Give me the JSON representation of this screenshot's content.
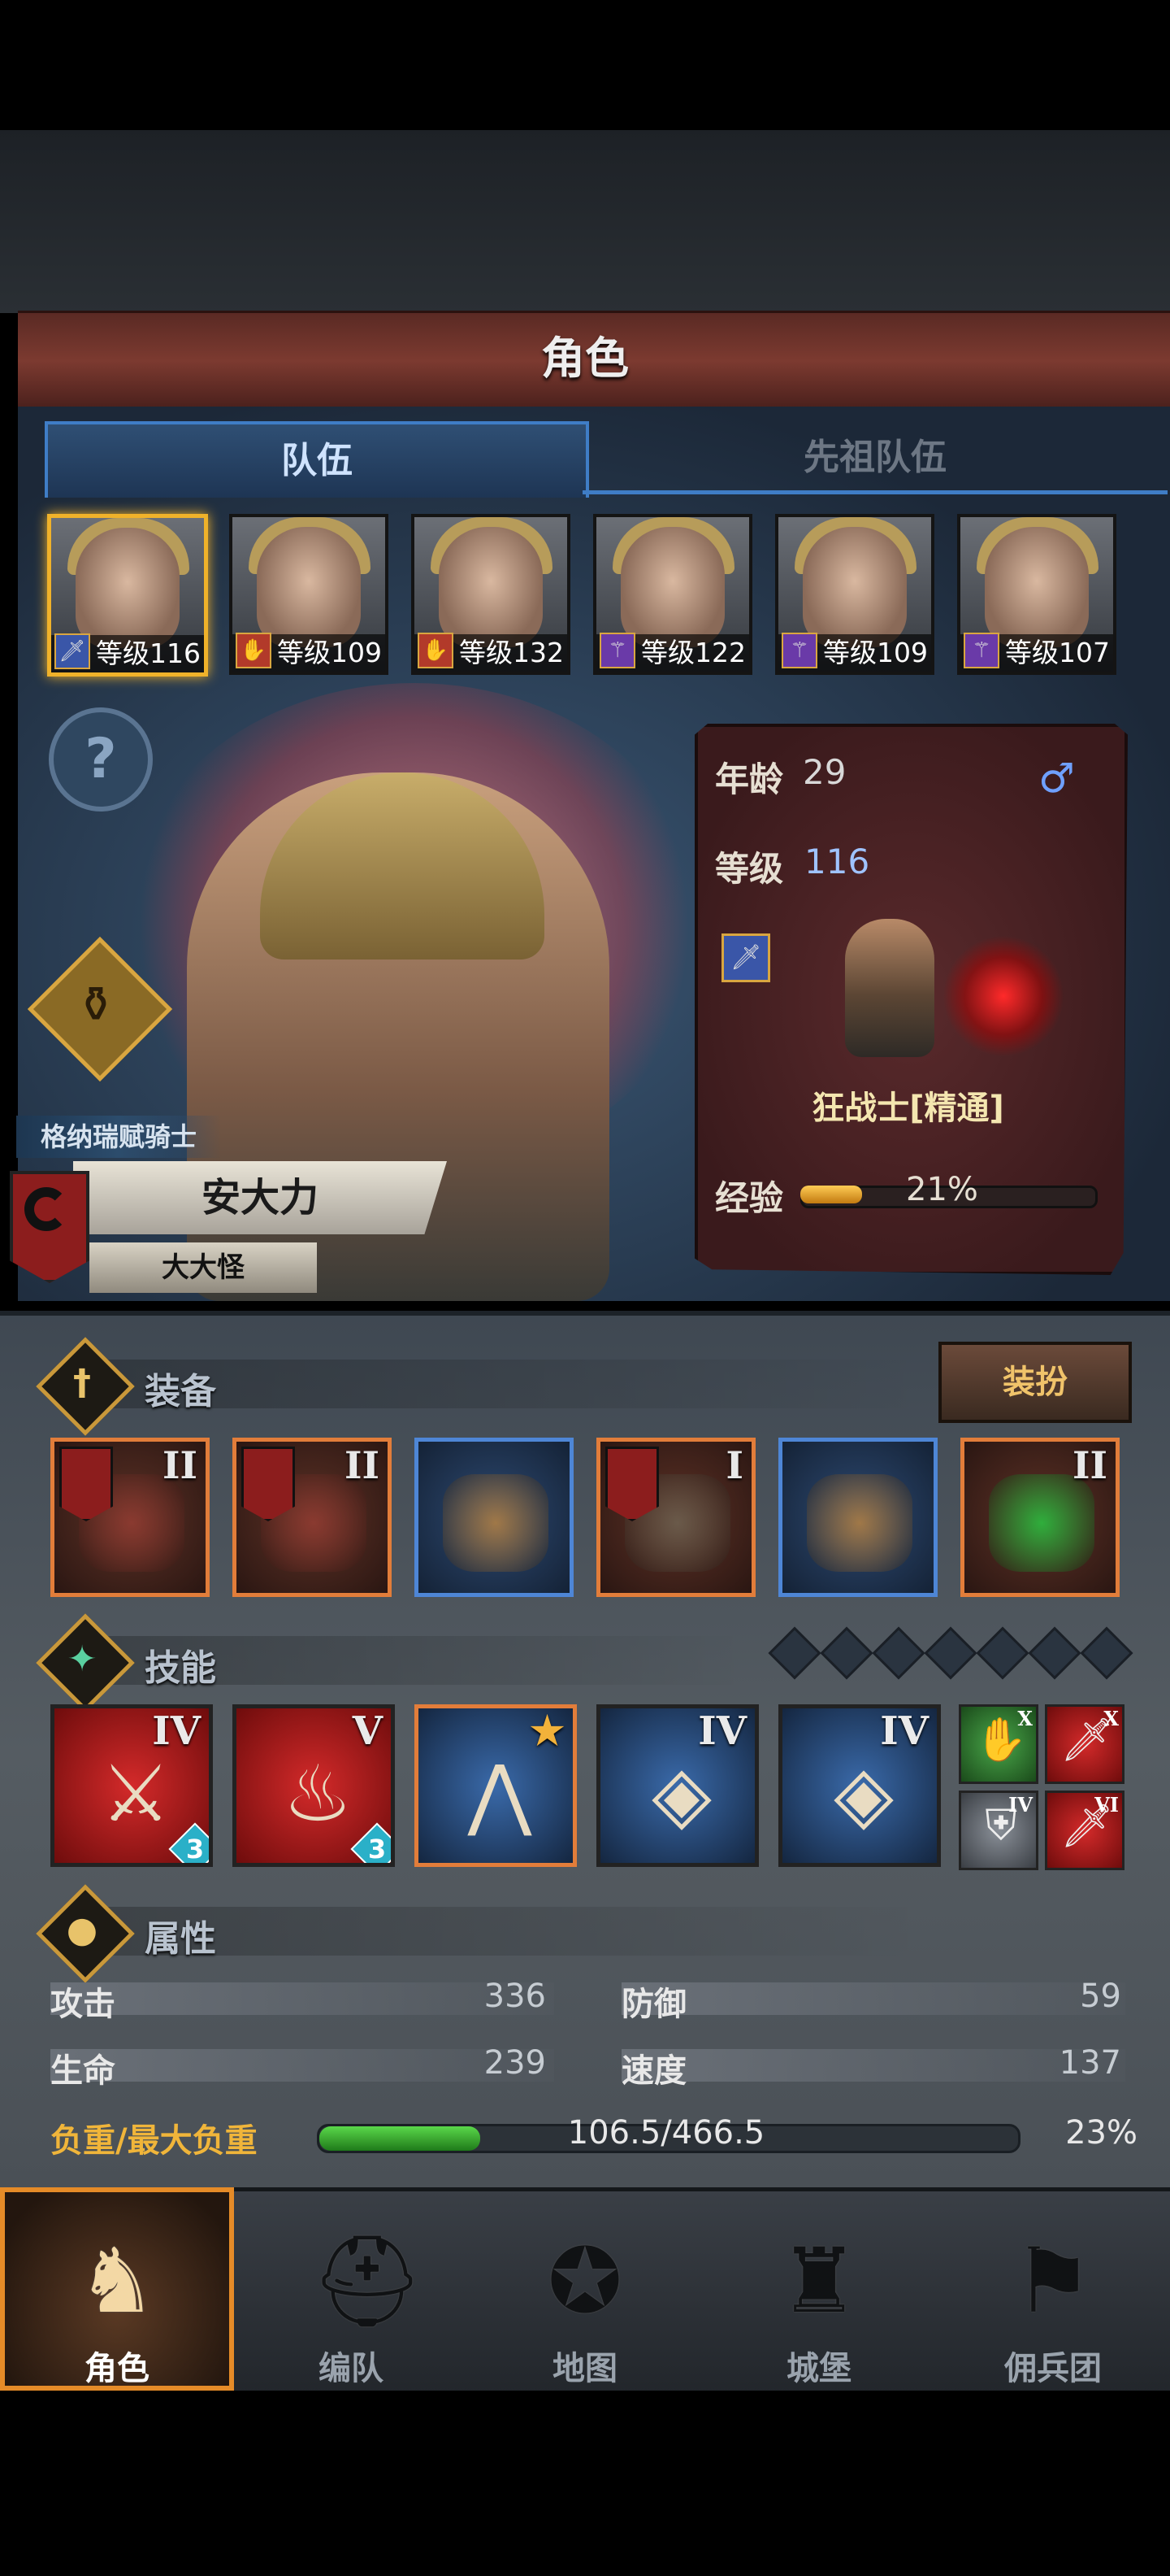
{
  "header": {
    "title": "角色"
  },
  "tabs": [
    {
      "label": "队伍"
    },
    {
      "label": "先祖队伍"
    }
  ],
  "roster": [
    {
      "level": "等级116",
      "class_color": "blue",
      "selected": true
    },
    {
      "level": "等级109",
      "class_color": "red"
    },
    {
      "level": "等级132",
      "class_color": "red"
    },
    {
      "level": "等级122",
      "class_color": "purple"
    },
    {
      "level": "等级109",
      "class_color": "purple"
    },
    {
      "level": "等级107",
      "class_color": "purple"
    }
  ],
  "character": {
    "order": "格纳瑞赋骑士",
    "name": "安大力",
    "nickname": "大大怪",
    "info": {
      "age_label": "年龄",
      "age": "29",
      "level_label": "等级",
      "level": "116",
      "class_name": "狂战士[精通]",
      "exp_label": "经验",
      "exp_pct": "21%",
      "exp_fraction": 0.21
    }
  },
  "equipment": {
    "title": "装备",
    "dress_button": "装扮",
    "items": [
      {
        "tier": "II",
        "rarity": "orange",
        "flag": true
      },
      {
        "tier": "II",
        "rarity": "orange",
        "flag": true
      },
      {
        "tier": "",
        "rarity": "blue",
        "flag": false
      },
      {
        "tier": "I",
        "rarity": "orange",
        "flag": true
      },
      {
        "tier": "",
        "rarity": "blue",
        "flag": false
      },
      {
        "tier": "II",
        "rarity": "orange",
        "flag": false
      }
    ]
  },
  "skills": {
    "title": "技能",
    "main": [
      {
        "tier": "IV",
        "color": "red",
        "count": "3"
      },
      {
        "tier": "V",
        "color": "red",
        "count": "3"
      },
      {
        "tier": "★",
        "color": "blue",
        "count": ""
      },
      {
        "tier": "IV",
        "color": "blue",
        "count": ""
      },
      {
        "tier": "IV",
        "color": "blue",
        "count": ""
      }
    ],
    "mini": [
      {
        "tier": "X",
        "color": "green"
      },
      {
        "tier": "X",
        "color": "red"
      },
      {
        "tier": "IV",
        "color": "gray"
      },
      {
        "tier": "VI",
        "color": "red"
      }
    ]
  },
  "attributes": {
    "title": "属性",
    "attack_label": "攻击",
    "attack": "336",
    "defense_label": "防御",
    "defense": "59",
    "hp_label": "生命",
    "hp": "239",
    "speed_label": "速度",
    "speed": "137",
    "weight_label": "负重/最大负重",
    "weight": "106.5/466.5",
    "weight_pct": "23%",
    "weight_fraction": 0.23
  },
  "nav": [
    {
      "label": "角色",
      "selected": true
    },
    {
      "label": "编队"
    },
    {
      "label": "地图"
    },
    {
      "label": "城堡"
    },
    {
      "label": "佣兵团"
    }
  ]
}
